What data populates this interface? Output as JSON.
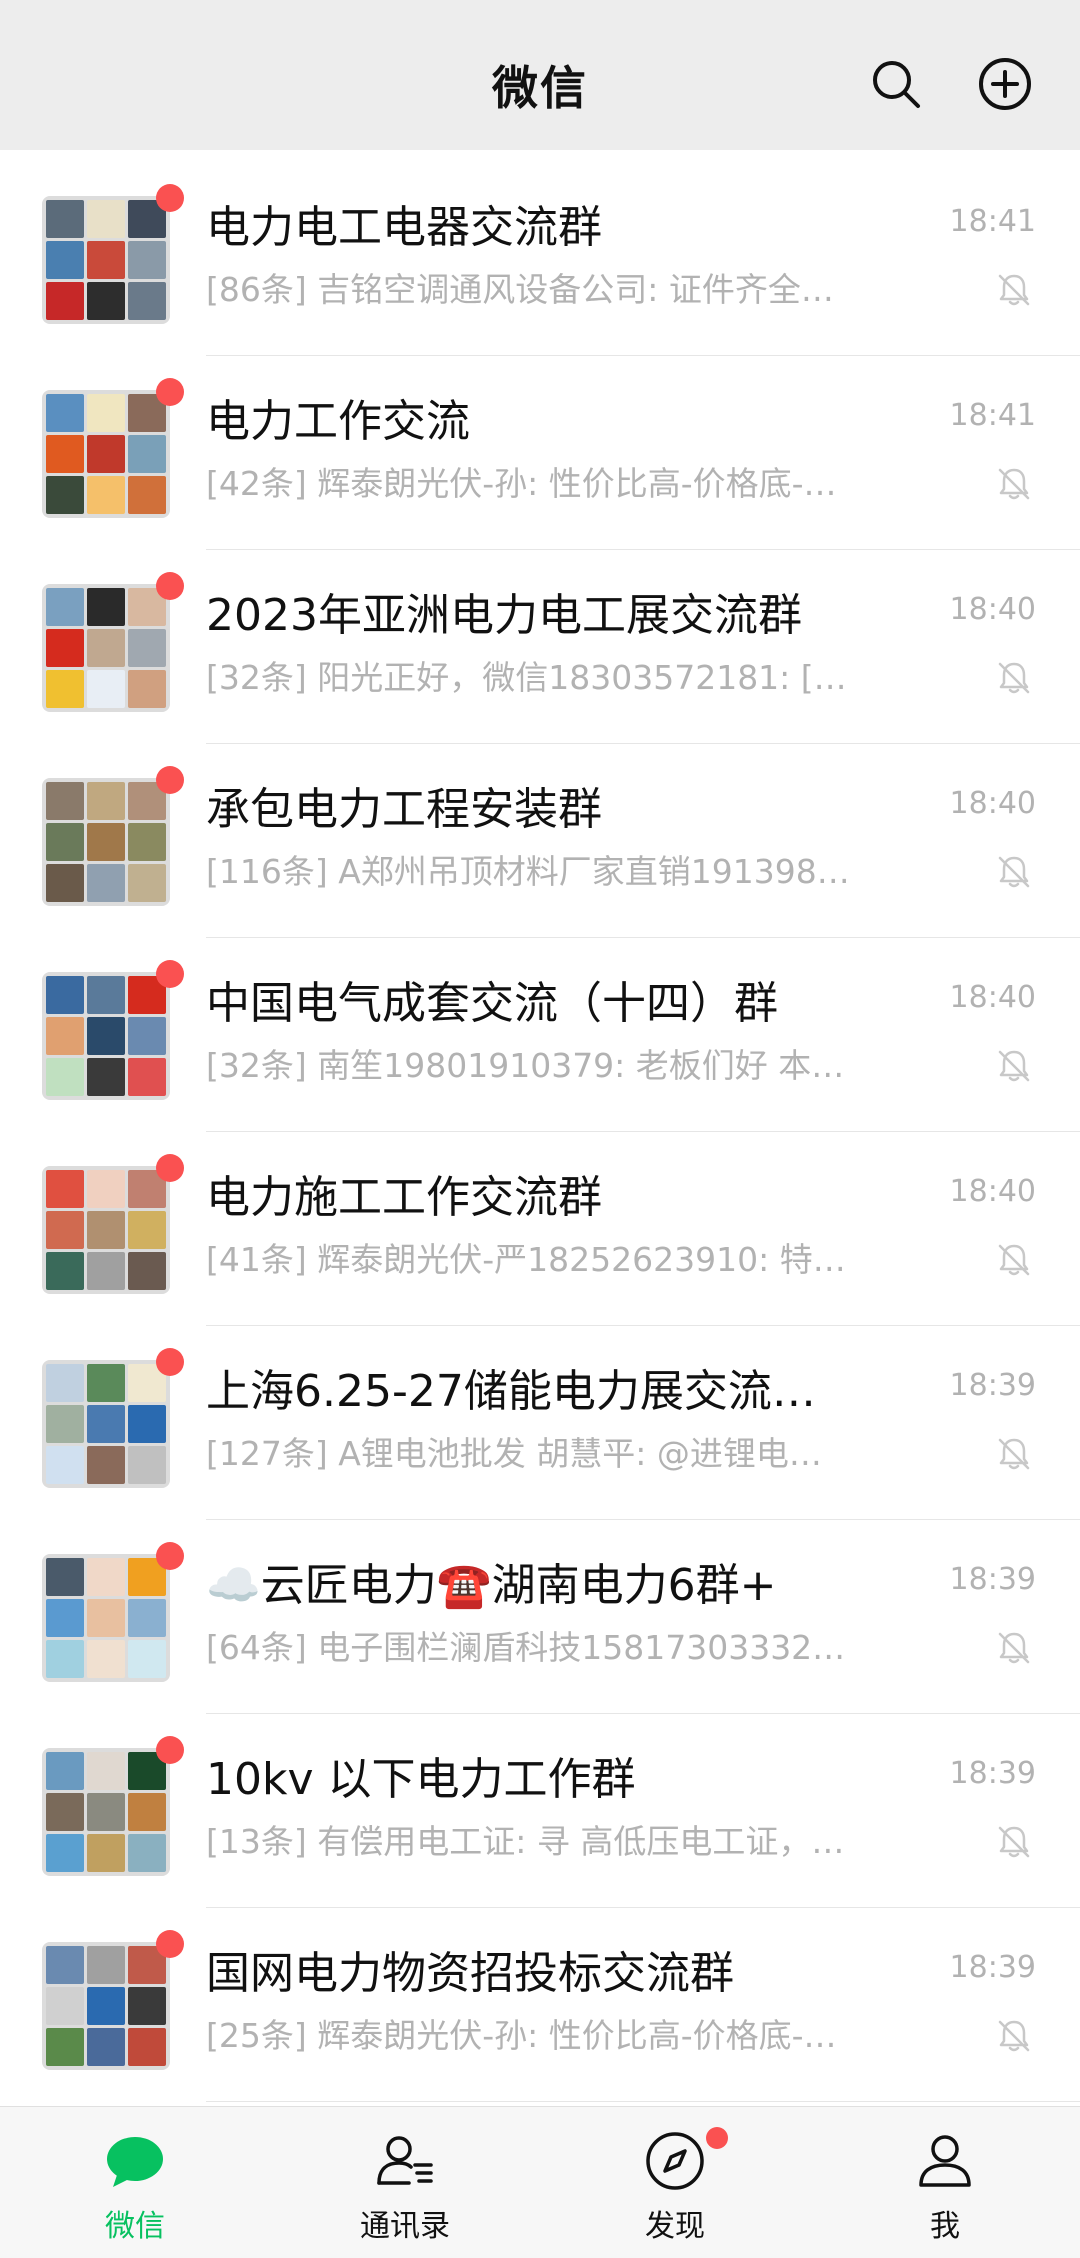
{
  "colors": {
    "accent": "#07c160",
    "unread": "#fa5151",
    "header_bg": "#ededed",
    "tabbar_bg": "#f7f7f7",
    "muted_text": "#b2b2b2"
  },
  "header": {
    "title": "微信",
    "search_icon": "search-icon",
    "add_icon": "add-circle-icon"
  },
  "chats": [
    {
      "name": "电力电工电器交流群",
      "preview": "[86条] 吉铭空调通风设备公司: 证件齐全…",
      "time": "18:41",
      "unread": true,
      "muted": true,
      "avatar_colors": [
        "#5b6b7a",
        "#e8e0c8",
        "#3f4a5a",
        "#4a7fb0",
        "#c94a3a",
        "#8a9aa8",
        "#c62828",
        "#2d2d2d",
        "#6a7a8a"
      ]
    },
    {
      "name": "电力工作交流",
      "preview": "[42条] 辉泰朗光伏-孙: 性价比高-价格底-…",
      "time": "18:41",
      "unread": true,
      "muted": true,
      "avatar_colors": [
        "#5a8fc0",
        "#f0e6c0",
        "#8a6a5a",
        "#e05a20",
        "#c0392b",
        "#7aa0b8",
        "#3a4a3a",
        "#f5c06a",
        "#d0703a"
      ]
    },
    {
      "name": "2023年亚洲电力电工展交流群",
      "preview": "[32条] 阳光正好，微信18303572181: […",
      "time": "18:40",
      "unread": true,
      "muted": true,
      "avatar_colors": [
        "#7aa0c0",
        "#2a2a2a",
        "#d8b8a0",
        "#d52b1e",
        "#c0a890",
        "#a0a8b0",
        "#f0c030",
        "#e8eef5",
        "#d0a080"
      ]
    },
    {
      "name": "承包电力工程安装群",
      "preview": "[116条] A郑州吊顶材料厂家直销191398…",
      "time": "18:40",
      "unread": true,
      "muted": true,
      "avatar_colors": [
        "#8a7a6a",
        "#c0a880",
        "#b0907a",
        "#6a7a5a",
        "#a0784a",
        "#8a8a60",
        "#6a5a4a",
        "#90a0b0",
        "#c0b090"
      ]
    },
    {
      "name": "中国电气成套交流（十四）群",
      "preview": "[32条] 南笙19801910379: 老板们好 本公…",
      "time": "18:40",
      "unread": true,
      "muted": true,
      "avatar_colors": [
        "#3a6aa0",
        "#5a7a9a",
        "#d52b1e",
        "#e0a070",
        "#2a4a6a",
        "#6a8ab0",
        "#c0e0c0",
        "#3a3a3a",
        "#e05050"
      ]
    },
    {
      "name": "电力施工工作交流群",
      "preview": "[41条] 辉泰朗光伏-严18252623910: 特…",
      "time": "18:40",
      "unread": true,
      "muted": true,
      "avatar_colors": [
        "#e05040",
        "#f0d0c0",
        "#c08070",
        "#d06a50",
        "#b09070",
        "#d0b060",
        "#3a6a5a",
        "#a0a0a0",
        "#6a5a50"
      ]
    },
    {
      "name": "上海6.25-27储能电力展交流…",
      "preview": "[127条] A锂电池批发   胡慧平: @进锂电…",
      "time": "18:39",
      "unread": true,
      "muted": true,
      "avatar_colors": [
        "#c0d0e0",
        "#5a8a5a",
        "#f0e8d0",
        "#a0b0a0",
        "#4a7ab0",
        "#2a6ab0",
        "#d0e0f0",
        "#8a6a5a",
        "#c0c0c0"
      ]
    },
    {
      "name": "☁️云匠电力☎️湖南电力6群+",
      "preview": "[64条] 电子围栏澜盾科技15817303332…",
      "time": "18:39",
      "unread": true,
      "muted": true,
      "avatar_colors": [
        "#4a5a6a",
        "#f0d8c8",
        "#f0a020",
        "#5a9ad0",
        "#e8c0a0",
        "#8ab0d0",
        "#a0d0e0",
        "#f0e0d0",
        "#d0e8f0"
      ]
    },
    {
      "name": "10kv 以下电力工作群",
      "preview": "[13条] 有偿用电工证: 寻  高低压电工证，…",
      "time": "18:39",
      "unread": true,
      "muted": true,
      "avatar_colors": [
        "#6a9ac0",
        "#e0d8d0",
        "#1a4a2a",
        "#7a6a5a",
        "#8a8a80",
        "#c08040",
        "#5aa0d0",
        "#c0a060",
        "#8ab0c0"
      ]
    },
    {
      "name": "国网电力物资招投标交流群",
      "preview": "[25条] 辉泰朗光伏-孙: 性价比高-价格底-…",
      "time": "18:39",
      "unread": true,
      "muted": true,
      "avatar_colors": [
        "#6a8ab0",
        "#a0a0a0",
        "#c05a4a",
        "#d0d0d0",
        "#2a6ab0",
        "#3a3a3a",
        "#5a8a4a",
        "#4a6a9a",
        "#c04a3a"
      ]
    }
  ],
  "tabbar": {
    "tabs": [
      {
        "label": "微信",
        "icon": "chat-bubble-icon",
        "active": true,
        "badge": false
      },
      {
        "label": "通讯录",
        "icon": "contacts-icon",
        "active": false,
        "badge": false
      },
      {
        "label": "发现",
        "icon": "compass-icon",
        "active": false,
        "badge": true
      },
      {
        "label": "我",
        "icon": "person-icon",
        "active": false,
        "badge": false
      }
    ]
  }
}
